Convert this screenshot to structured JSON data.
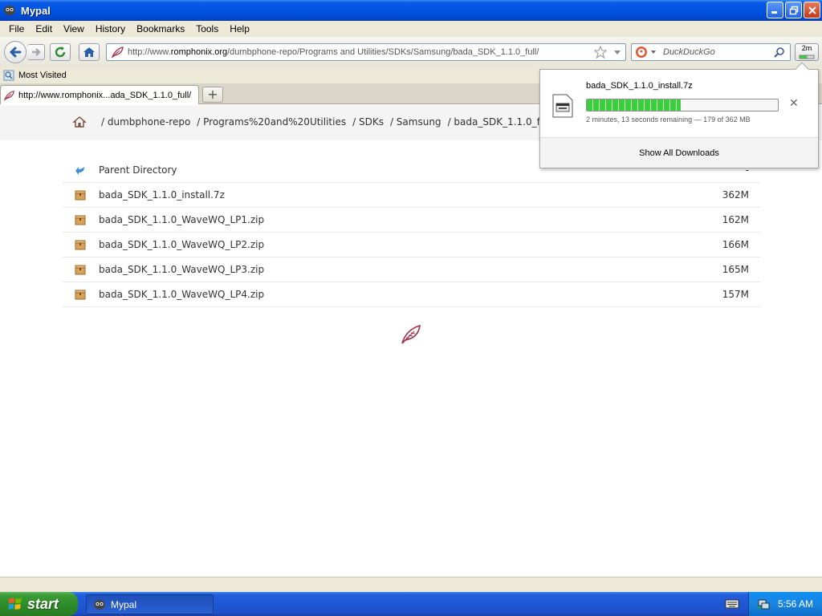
{
  "window": {
    "title": "Mypal"
  },
  "menu": {
    "items": [
      "File",
      "Edit",
      "View",
      "History",
      "Bookmarks",
      "Tools",
      "Help"
    ]
  },
  "navbar": {
    "url_prefix": "http://www.",
    "url_host": "romphonix.org",
    "url_path": "/dumbphone-repo/Programs and Utilities/SDKs/Samsung/bada_SDK_1.1.0_full/",
    "search_placeholder": "DuckDuckGo",
    "downloads_button_label": "2m"
  },
  "bookmarks": {
    "most_visited": "Most Visited"
  },
  "tabs": [
    {
      "label": "http://www.romphonix...ada_SDK_1.1.0_full/"
    }
  ],
  "breadcrumb": [
    "/ dumbphone-repo",
    "/ Programs%20and%20Utilities",
    "/ SDKs",
    "/ Samsung",
    "/ bada_SDK_1.1.0_full",
    "/"
  ],
  "listing": {
    "parent": {
      "name": "Parent Directory",
      "size": "-"
    },
    "files": [
      {
        "name": "bada_SDK_1.1.0_install.7z",
        "size": "362M"
      },
      {
        "name": "bada_SDK_1.1.0_WaveWQ_LP1.zip",
        "size": "162M"
      },
      {
        "name": "bada_SDK_1.1.0_WaveWQ_LP2.zip",
        "size": "166M"
      },
      {
        "name": "bada_SDK_1.1.0_WaveWQ_LP3.zip",
        "size": "165M"
      },
      {
        "name": "bada_SDK_1.1.0_WaveWQ_LP4.zip",
        "size": "157M"
      }
    ]
  },
  "download_panel": {
    "filename": "bada_SDK_1.1.0_install.7z",
    "progress_fraction": 0.49,
    "status": "2 minutes, 13 seconds remaining — 179 of 362 MB",
    "show_all": "Show All Downloads"
  },
  "taskbar": {
    "start_label": "start",
    "task_label": "Mypal",
    "clock": "5:56 AM"
  },
  "colors": {
    "progress_green": "#3bd03b",
    "titlebar_blue": "#0054e3",
    "start_green": "#2f8c2a"
  }
}
